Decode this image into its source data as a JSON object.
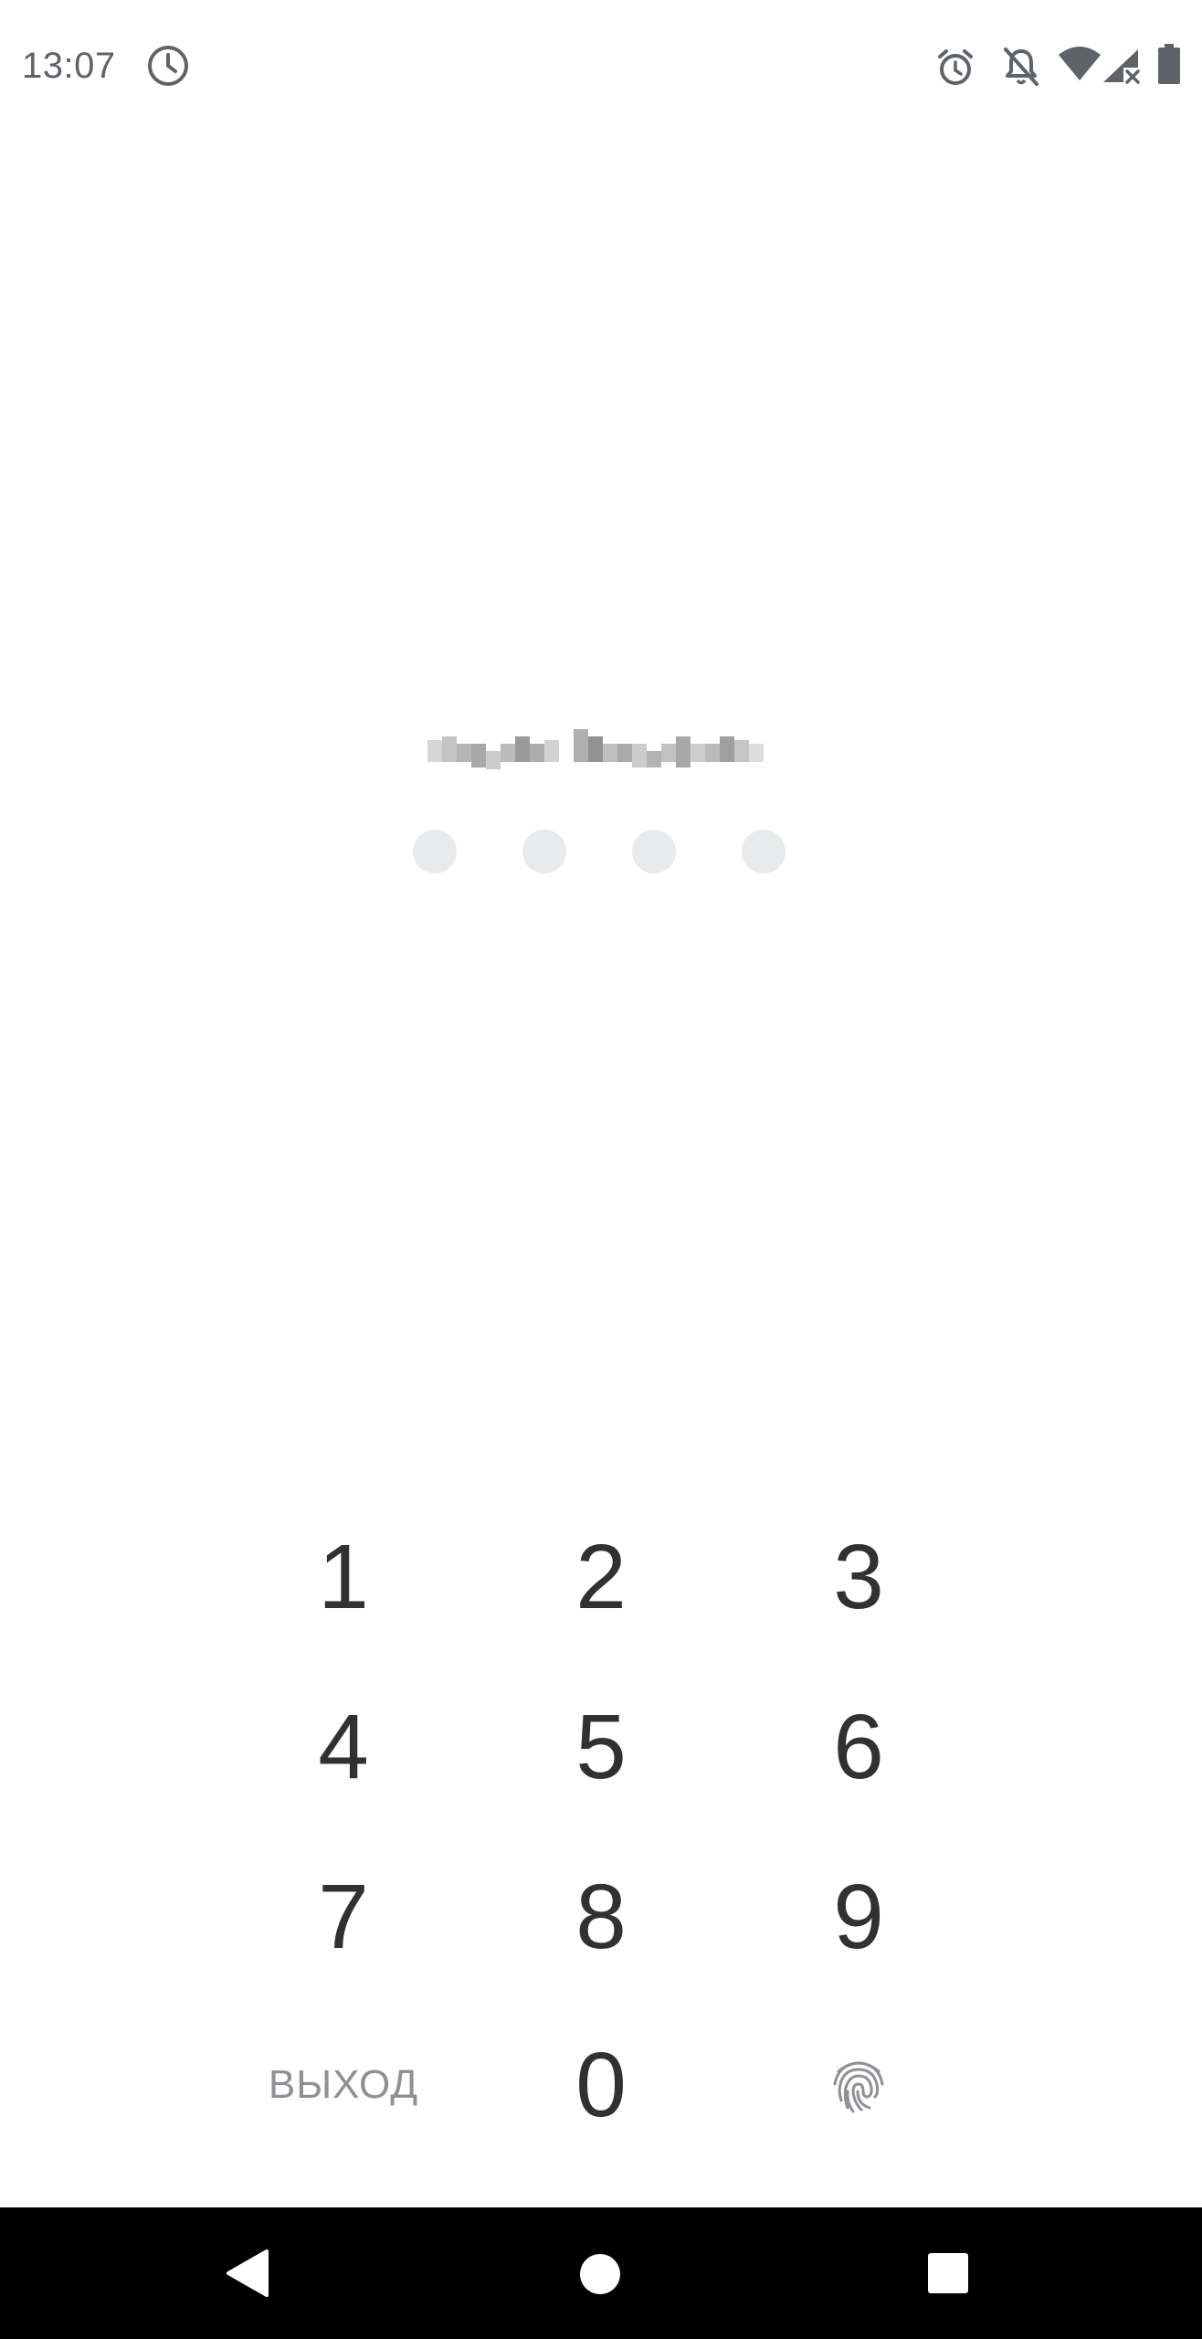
{
  "status_bar": {
    "time": "13:07",
    "icons": [
      "clock-icon",
      "alarm-icon",
      "notifications-off-icon",
      "wifi-icon",
      "cellular-no-signal-icon",
      "battery-icon"
    ]
  },
  "lock_screen": {
    "account_name_redacted": true,
    "pin_dots_count": 4
  },
  "keypad": {
    "keys": [
      "1",
      "2",
      "3",
      "4",
      "5",
      "6",
      "7",
      "8",
      "9",
      "0"
    ],
    "exit_label": "ВЫХОД",
    "fingerprint_icon": "fingerprint-icon"
  },
  "nav_bar": {
    "icons": [
      "back-icon",
      "home-icon",
      "recents-icon"
    ]
  },
  "colors": {
    "background": "#ffffff",
    "digit_text": "#303133",
    "muted_text": "#8e9093",
    "pin_dot": "#e9eaeb",
    "status_icons": "#5f6368",
    "nav_bar": "#000000"
  }
}
